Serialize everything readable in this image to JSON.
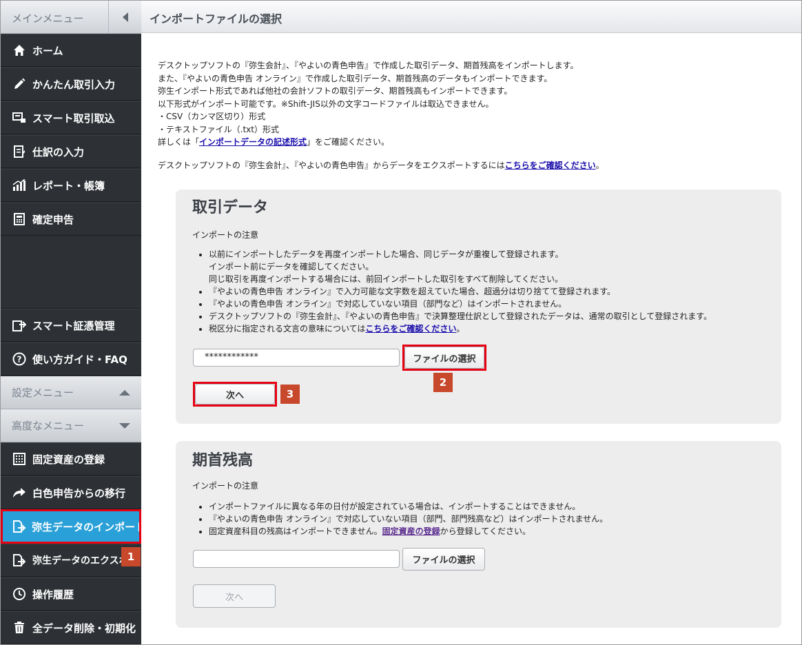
{
  "sidebar": {
    "header": "メインメニュー",
    "items_top": [
      {
        "label": "ホーム",
        "icon": "home-icon"
      },
      {
        "label": "かんたん取引入力",
        "icon": "pencil-icon"
      },
      {
        "label": "スマート取引取込",
        "icon": "import-icon"
      },
      {
        "label": "仕訳の入力",
        "icon": "journal-icon"
      },
      {
        "label": "レポート・帳簿",
        "icon": "report-icon"
      },
      {
        "label": "確定申告",
        "icon": "calculator-icon"
      }
    ],
    "items_mid": [
      {
        "label": "スマート証憑管理",
        "icon": "document-upload-icon"
      },
      {
        "label": "使い方ガイド・FAQ",
        "icon": "help-icon"
      }
    ],
    "settings_menu": "設定メニュー",
    "advanced_menu": "高度なメニュー",
    "items_adv": [
      {
        "label": "固定資産の登録",
        "icon": "building-icon"
      },
      {
        "label": "白色申告からの移行",
        "icon": "share-arrow-icon"
      },
      {
        "label": "弥生データのインポート",
        "icon": "file-import-icon",
        "active": true
      },
      {
        "label": "弥生データのエクスポート",
        "icon": "file-export-icon"
      },
      {
        "label": "操作履歴",
        "icon": "history-icon"
      },
      {
        "label": "全データ削除・初期化",
        "icon": "trash-icon"
      }
    ]
  },
  "page_title": "インポートファイルの選択",
  "intro": {
    "line1": "デスクトップソフトの『弥生会計』、『やよいの青色申告』で作成した取引データ、期首残高をインポートします。",
    "line2": "また、『やよいの青色申告 オンライン』で作成した取引データ、期首残高のデータもインポートできます。",
    "line3": "弥生インポート形式であれば他社の会計ソフトの取引データ、期首残高もインポートできます。",
    "line4": "以下形式がインポート可能です。※Shift-JIS以外の文字コードファイルは取込できません。",
    "line5": "・CSV（カンマ区切り）形式",
    "line6": "・テキストファイル（.txt）形式",
    "line7_pre": "詳しくは「",
    "line7_link": "インポートデータの記述形式",
    "line7_post": "」をご確認ください。",
    "export_pre": "デスクトップソフトの『弥生会計』、『やよいの青色申告』からデータをエクスポートするには",
    "export_link": "こちらをご確認ください",
    "export_post": "。"
  },
  "torihiki": {
    "title": "取引データ",
    "note_title": "インポートの注意",
    "notes": {
      "n1a": "以前にインポートしたデータを再度インポートした場合、同じデータが重複して登録されます。",
      "n1b": "インポート前にデータを確認してください。",
      "n1c": "同じ取引を再度インポートする場合には、前回インポートした取引をすべて削除してください。",
      "n2": "『やよいの青色申告 オンライン』で入力可能な文字数を超えていた場合、超過分は切り捨てて登録されます。",
      "n3": "『やよいの青色申告 オンライン』で対応していない項目（部門など）はインポートされません。",
      "n4": "デスクトップソフトの『弥生会計』、『やよいの青色申告』で決算整理仕訳として登録されたデータは、通常の取引として登録されます。",
      "n5_pre": "税区分に指定される文言の意味については",
      "n5_link": "こちらをご確認ください",
      "n5_post": "。"
    },
    "file_value": "************",
    "select_button": "ファイルの選択",
    "next_button": "次へ"
  },
  "kishu": {
    "title": "期首残高",
    "note_title": "インポートの注意",
    "notes": {
      "n1": "インポートファイルに異なる年の日付が設定されている場合は、インポートすることはできません。",
      "n2": "『やよいの青色申告 オンライン』で対応していない項目（部門、部門残高など）はインポートされません。",
      "n3_pre": "固定資産科目の残高はインポートできません。",
      "n3_link": "固定資産の登録",
      "n3_post": "から登録してください。"
    },
    "file_value": "",
    "select_button": "ファイルの選択",
    "next_button": "次へ"
  },
  "badges": {
    "b1": "1",
    "b2": "2",
    "b3": "3"
  },
  "colors": {
    "active": "#2aa0d8",
    "highlight": "#e60012",
    "badge": "#c8482b",
    "sidebar_bg": "#2d3135"
  }
}
